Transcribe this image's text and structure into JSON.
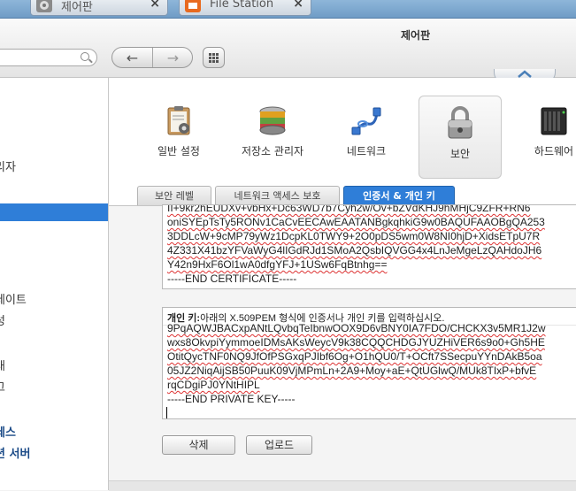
{
  "tabs": [
    {
      "label": "제어판",
      "close": "×"
    },
    {
      "label": "File Station",
      "close": "×"
    }
  ],
  "window": {
    "title": "제어판"
  },
  "toolbar": {
    "back": "←",
    "forward": "→",
    "grid": "⋮⋮⋮",
    "collapse": "︿"
  },
  "sidebar": {
    "items": [
      {
        "label": "리자"
      },
      {
        "label": ""
      },
      {
        "label": "데이트"
      },
      {
        "label": "성"
      },
      {
        "label": "태"
      },
      {
        "label": "그"
      },
      {
        "label": "세스"
      },
      {
        "label": "션 서버"
      }
    ]
  },
  "categories": [
    {
      "label": "일반 설정"
    },
    {
      "label": "저장소 관리자"
    },
    {
      "label": "네트워크"
    },
    {
      "label": "보안"
    },
    {
      "label": "하드웨어"
    }
  ],
  "subtabs": [
    {
      "label": "보안 레벨"
    },
    {
      "label": "네트워크 액세스 보호"
    },
    {
      "label": "인증서 & 개인 키"
    }
  ],
  "certificate": {
    "lines": [
      "II+9kr2hEUDXv+vbHx+Dc63WD7b7Cyh2w/Ov+bZVdKHJ9hMHjC9ZFR+RN6",
      "oniSYEpTsTy5RONv1CaCvEECAwEAATANBgkqhkiG9w0BAQUFAAOBgQA253",
      "3DDLcW+9cMP79yWz1DcpKL0TWY9+2O0pDS5wm0W8NI0hjD+XidsETpU7R",
      "4Z331X41bzYFVaWyG4lIGdRJd1SMoA2QsbIQVGG4x4LnJeMgeLzQAHdoJH6",
      "Y42n9HxF6Ol1wA0dfgYFJ+1USw6FqBtnhg==",
      "-----END CERTIFICATE-----"
    ]
  },
  "private_key": {
    "label_bold": "개인 키:",
    "label_text": "아래의 X.509PEM 형식에 인증서나 개인 키를 입력하십시오.",
    "lines": [
      "9PqAQWJBACxpANtLQvbqTeIbnwOOX9D6vBNY0IA7FDO/CHCKX3v5MR1J2w",
      "wxs8OkvpiYymmoeIDMsAKsWeycV9k38CQQCHDGJYUZHiVER6s9o0+Gh5HE",
      "OtitQycTNF0NQ9JfOfPSGxqPJIbf6Og+O1hQU0/T+OCft7SSecpuYYnDAkB5oa",
      "05JZ2NiqAijSB50PuuK09VjMPmLn+2A9+Moy+aE+QtUGlwQ/MUk8TIxP+bfvE",
      "rqCDgiPJ0YNtHIPL",
      "-----END PRIVATE KEY-----"
    ]
  },
  "buttons": {
    "delete": "삭제",
    "upload": "업로드"
  }
}
